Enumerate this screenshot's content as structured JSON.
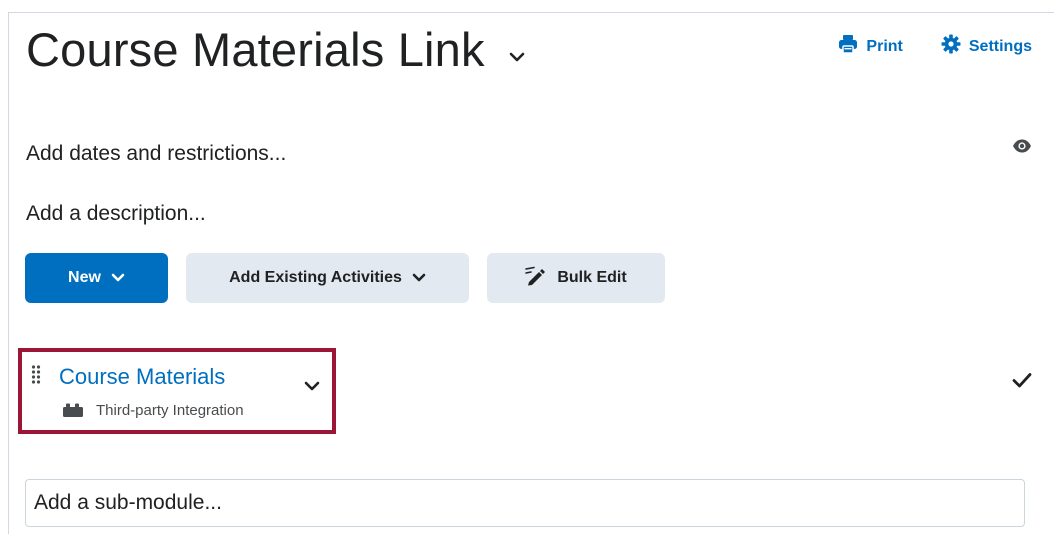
{
  "header": {
    "title": "Course Materials Link",
    "title_menu_icon": "chevron-down-icon"
  },
  "top_actions": {
    "print_label": "Print",
    "print_icon": "printer-icon",
    "settings_label": "Settings",
    "settings_icon": "gear-icon"
  },
  "visibility_icon": "eye-icon",
  "inline_fields": {
    "dates_placeholder": "Add dates and restrictions...",
    "description_placeholder": "Add a description..."
  },
  "toolbar": {
    "new_label": "New",
    "add_existing_label": "Add Existing Activities",
    "bulk_edit_label": "Bulk Edit",
    "bulk_edit_icon": "pencil-icon"
  },
  "activity": {
    "title": "Course Materials",
    "type_label": "Third-party Integration",
    "type_icon": "puzzle-icon",
    "status_icon": "checkmark-icon"
  },
  "submodule": {
    "placeholder": "Add a sub-module..."
  },
  "colors": {
    "primary": "#006fbf",
    "secondary_button": "#e3e9f1",
    "highlight_border": "#9d1535",
    "text": "#202122"
  }
}
